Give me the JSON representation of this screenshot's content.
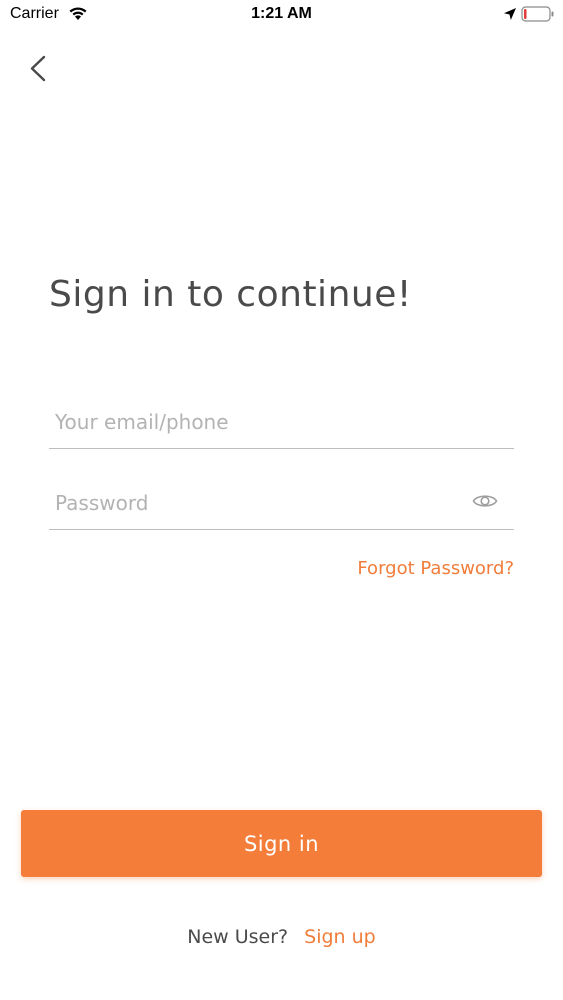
{
  "status_bar": {
    "carrier": "Carrier",
    "time": "1:21 AM",
    "icons": [
      "wifi-icon",
      "location-icon",
      "battery-icon"
    ],
    "battery_color": "#e23b3b"
  },
  "nav": {
    "back_icon": "chevron-left-icon"
  },
  "title": "Sign in to continue!",
  "form": {
    "email_placeholder": "Your email/phone",
    "email_value": "",
    "password_placeholder": "Password",
    "password_value": "",
    "password_toggle_icon": "eye-icon",
    "forgot_password": "Forgot Password?"
  },
  "actions": {
    "sign_in_label": "Sign in"
  },
  "footer": {
    "new_user": "New User?",
    "sign_up": "Sign up"
  },
  "colors": {
    "accent": "#f47d3a",
    "link": "#f07d3a",
    "title": "#4a4a4a",
    "placeholder": "#b3b3b3",
    "divider": "#bdbdbd"
  }
}
